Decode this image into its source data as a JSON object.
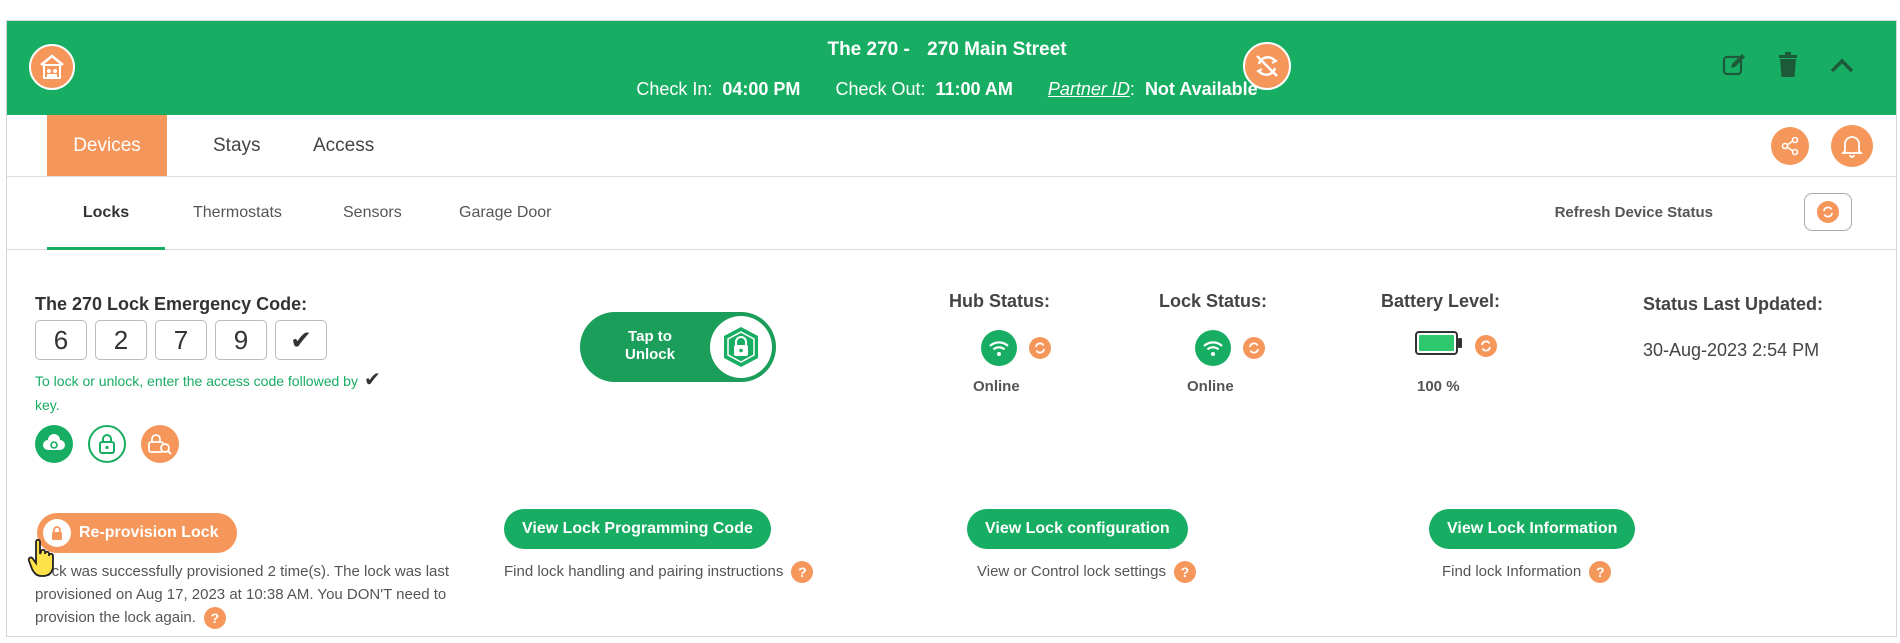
{
  "header": {
    "property_name": "The 270 -",
    "address": "270 Main Street",
    "check_in_label": "Check In:",
    "check_in_value": "04:00 PM",
    "check_out_label": "Check Out:",
    "check_out_value": "11:00 AM",
    "partner_id_label": "Partner ID",
    "partner_id_colon": ":",
    "partner_id_value": "Not Available",
    "icons": [
      "home-icon",
      "no-sync-icon",
      "edit-icon",
      "trash-icon",
      "chevron-up-icon"
    ]
  },
  "main_tabs": [
    {
      "label": "Devices",
      "active": true
    },
    {
      "label": "Stays",
      "active": false
    },
    {
      "label": "Access",
      "active": false
    }
  ],
  "sub_tabs": [
    {
      "label": "Locks",
      "active": true
    },
    {
      "label": "Thermostats",
      "active": false
    },
    {
      "label": "Sensors",
      "active": false
    },
    {
      "label": "Garage Door",
      "active": false
    }
  ],
  "refresh": {
    "label": "Refresh Device Status"
  },
  "emergency": {
    "title": "The 270 Lock Emergency Code:",
    "digits": [
      "6",
      "2",
      "7",
      "9",
      "✔"
    ],
    "hint": "To lock or unlock, enter the access code followed by",
    "hint_check": "✔",
    "hint_end": "key."
  },
  "unlock": {
    "label": "Tap to Unlock"
  },
  "status": {
    "hub_title": "Hub Status:",
    "hub_value": "Online",
    "lock_title": "Lock Status:",
    "lock_value": "Online",
    "battery_title": "Battery Level:",
    "battery_value": "100 %",
    "battery_level": 1.0,
    "updated_title": "Status Last Updated:",
    "updated_value": "30-Aug-2023 2:54 PM"
  },
  "actions": {
    "reprovision": {
      "label": "Re-provision Lock",
      "desc": "Lock was successfully provisioned 2 time(s). The lock was last provisioned on Aug 17, 2023 at 10:38 AM. You DON'T need to provision the lock again."
    },
    "programming": {
      "label": "View Lock Programming Code",
      "desc": "Find lock handling and pairing instructions"
    },
    "configuration": {
      "label": "View Lock configuration",
      "desc": "View or Control lock settings"
    },
    "information": {
      "label": "View Lock Information",
      "desc": "Find lock Information"
    },
    "help_glyph": "?"
  },
  "colors": {
    "green": "#17ad63",
    "orange": "#f5965a"
  }
}
